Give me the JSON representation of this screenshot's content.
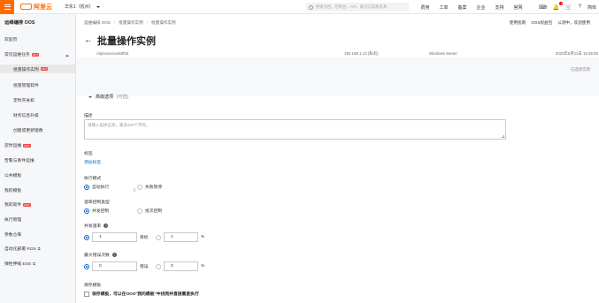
{
  "topbar": {
    "logo_text": "阿里云",
    "region": "华东1（杭州）",
    "search_placeholder": "搜索文档、控制台、API、解决方案和资源",
    "links": [
      "费用",
      "工单",
      "备案",
      "企业",
      "支持",
      "官网"
    ],
    "language": "简体",
    "notification_count": "1"
  },
  "sidebar": {
    "title": "运维编排 OOS",
    "items": [
      {
        "label": "欢迎页",
        "hot": false
      },
      {
        "label": "常见运维任务",
        "hot": true
      },
      {
        "label": "批量操作实例",
        "hot": true,
        "active": true
      },
      {
        "label": "批量管理软件",
        "hot": false
      },
      {
        "label": "定时开关机",
        "hot": false
      },
      {
        "label": "财务信息升级",
        "hot": false
      },
      {
        "label": "创建或更新镜像",
        "hot": false
      },
      {
        "label": "定时运维",
        "hot": true
      },
      {
        "label": "告警与事件运维",
        "hot": false
      },
      {
        "label": "公共模板",
        "hot": false
      },
      {
        "label": "我的模板",
        "hot": false
      },
      {
        "label": "我的软件",
        "hot": true
      },
      {
        "label": "执行管理",
        "hot": false
      },
      {
        "label": "参数仓库",
        "hot": false
      },
      {
        "label": "自动化部署 ROS",
        "ext": true
      },
      {
        "label": "弹性伸缩 ESS",
        "ext": true
      }
    ],
    "hot_label": "HOT"
  },
  "breadcrumb": [
    "运维编排 OOS",
    "批量操作实例",
    "批量操作实例"
  ],
  "header_links": [
    "使用指南",
    "OOS权益包",
    "公测中，欢迎使用"
  ],
  "page_title": "批量操作实例",
  "table_row": [
    "i-bp1xxxxxxx58f3d",
    "192.168.1.12 (私有)",
    "Windows Server",
    "2020年6月11日 15:35:55"
  ],
  "selected_note": "已选择实例",
  "advanced": {
    "title": "高级选项",
    "subtitle": "(可选)"
  },
  "description": {
    "label": "描述",
    "placeholder": "请输入描述信息，最多200个字符。"
  },
  "tags": {
    "label": "标签",
    "link": "添加标签"
  },
  "exec_mode": {
    "label": "执行模式",
    "options": [
      "自动执行",
      "失败暂停"
    ],
    "selected": 0
  },
  "concurrency_type": {
    "label": "速率控制类型",
    "options": [
      "并发控制",
      "批次控制"
    ],
    "selected": 0
  },
  "concurrency_rate": {
    "label": "并发速率",
    "value": "1",
    "unit1": "目标",
    "percent_value": "1",
    "unit2": "%"
  },
  "max_errors": {
    "label": "最大错误次数",
    "value": "0",
    "unit1": "错误",
    "percent_value": "0",
    "unit2": "%"
  },
  "save_template": {
    "label": "保存模板",
    "checkbox_label": "保存模板，可以在OOS\"我的模板\"中找到并直接重复执行"
  }
}
